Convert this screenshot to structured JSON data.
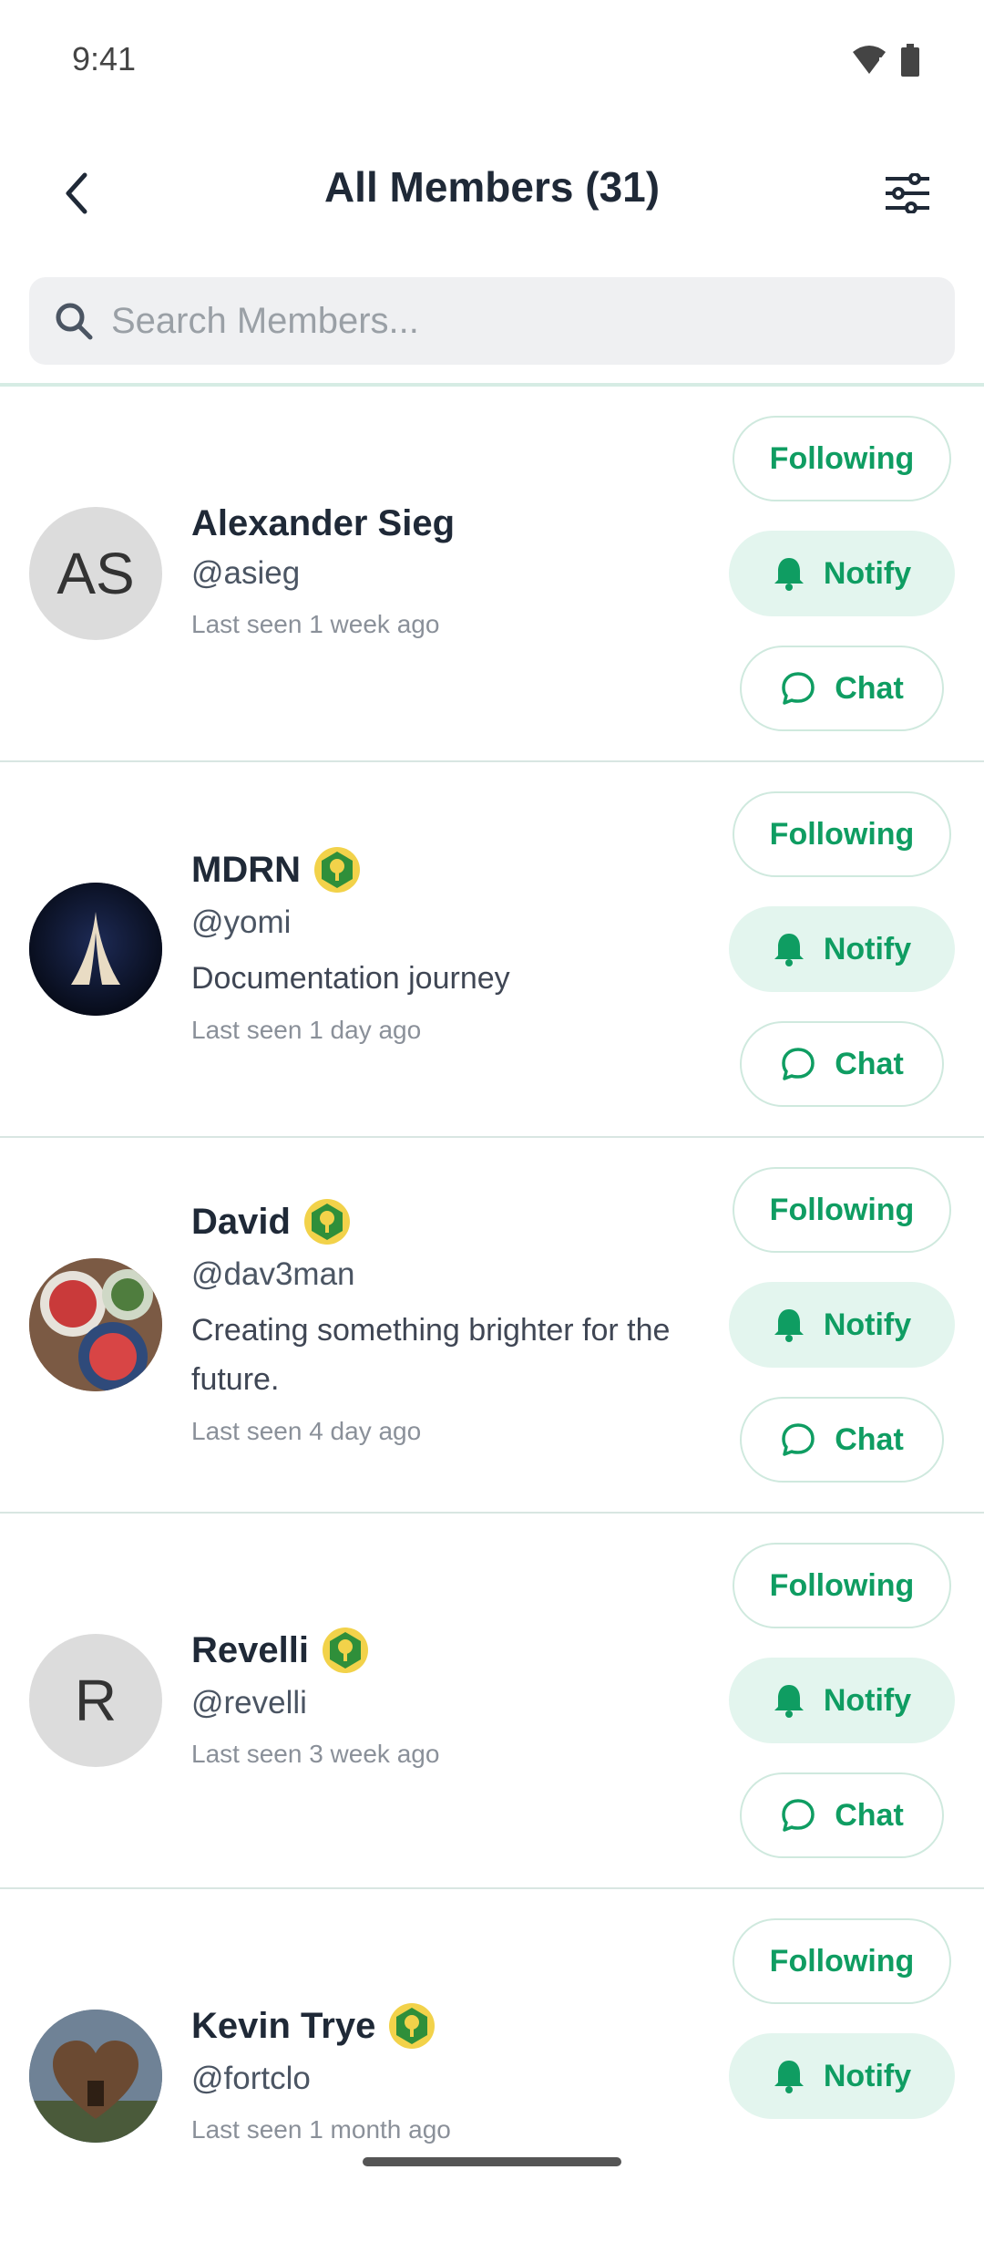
{
  "status": {
    "time": "9:41"
  },
  "header": {
    "title": "All Members (31)"
  },
  "search": {
    "placeholder": "Search Members..."
  },
  "members": [
    {
      "initials": "AS",
      "name": "Alexander Sieg",
      "handle": "@asieg",
      "bio": "",
      "last_seen": "Last seen 1 week ago",
      "badge": false
    },
    {
      "initials": "",
      "name": "MDRN",
      "handle": "@yomi",
      "bio": "Documentation journey",
      "last_seen": "Last seen 1 day ago",
      "badge": true
    },
    {
      "initials": "",
      "name": "David",
      "handle": "@dav3man",
      "bio": "Creating something brighter for the future.",
      "last_seen": "Last seen 4 day ago",
      "badge": true
    },
    {
      "initials": "R",
      "name": "Revelli",
      "handle": "@revelli",
      "bio": "",
      "last_seen": "Last seen 3 week ago",
      "badge": true
    },
    {
      "initials": "",
      "name": "Kevin Trye",
      "handle": "@fortclo",
      "bio": "",
      "last_seen": "Last seen 1 month ago",
      "badge": true
    }
  ],
  "actions": {
    "following": "Following",
    "notify": "Notify",
    "chat": "Chat"
  },
  "colors": {
    "accent": "#0f9d62",
    "notify_bg": "#e3f5ee"
  }
}
